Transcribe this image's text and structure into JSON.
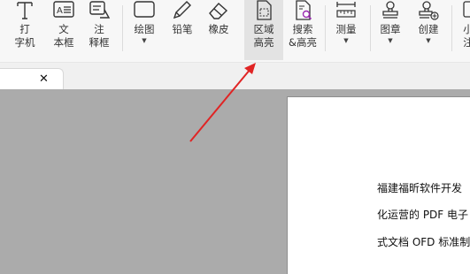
{
  "toolbar": {
    "typewriter": "打\n字机",
    "textbox": "文\n本框",
    "callout": "注\n释框",
    "drawing": "绘图",
    "pencil": "铅笔",
    "eraser": "橡皮",
    "area_highlight": "区域\n高亮",
    "search_highlight": "搜索\n&高亮",
    "measure": "测量",
    "stamp": "图章",
    "create": "创建",
    "partial": "小\n注"
  },
  "tab": {
    "close_glyph": "✕"
  },
  "document": {
    "lines": [
      "福建福昕软件开发",
      "化运营的 PDF 电子",
      "式文档 OFD 标准制"
    ]
  },
  "colors": {
    "arrow": "#e02424",
    "ribbon": "#f7f7f7",
    "workspace": "#ababab"
  }
}
